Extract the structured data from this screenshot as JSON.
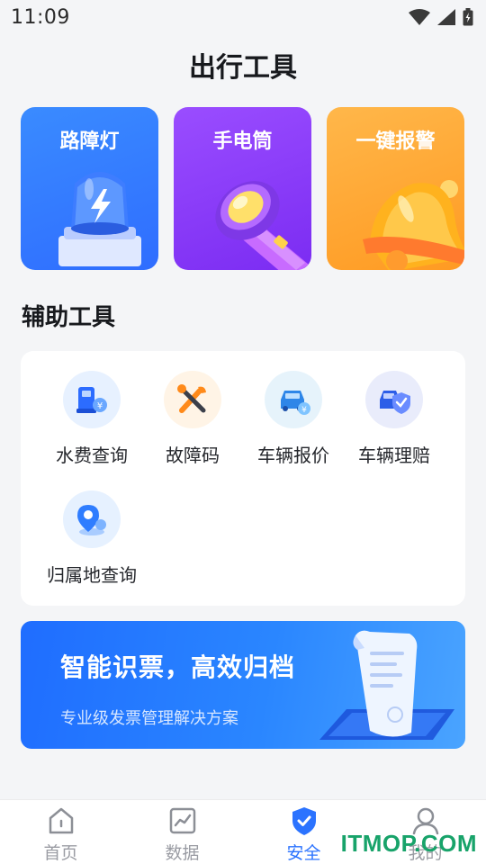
{
  "status_bar": {
    "time": "11:09"
  },
  "page_title": "出行工具",
  "tool_cards": [
    {
      "label": "路障灯",
      "icon": "warning-light-icon"
    },
    {
      "label": "手电筒",
      "icon": "flashlight-icon"
    },
    {
      "label": "一键报警",
      "icon": "bell-icon"
    }
  ],
  "aux_section": {
    "title": "辅助工具",
    "items": [
      {
        "label": "水费查询",
        "icon": "water-fee-icon"
      },
      {
        "label": "故障码",
        "icon": "tools-icon"
      },
      {
        "label": "车辆报价",
        "icon": "car-price-icon"
      },
      {
        "label": "车辆理赔",
        "icon": "car-claim-icon"
      },
      {
        "label": "归属地查询",
        "icon": "location-icon"
      }
    ]
  },
  "banner": {
    "title": "智能识票，高效归档",
    "subtitle": "专业级发票管理解决方案"
  },
  "tab_bar": {
    "tabs": [
      {
        "label": "首页",
        "icon": "home-icon",
        "active": false
      },
      {
        "label": "数据",
        "icon": "chart-icon",
        "active": false
      },
      {
        "label": "安全",
        "icon": "shield-icon",
        "active": true
      },
      {
        "label": "我的",
        "icon": "user-icon",
        "active": false
      }
    ]
  },
  "watermark": "ITMOP.COM",
  "colors": {
    "accent": "#2b73ff",
    "roadblock_card": "#3a8bff",
    "flashlight_card": "#8a3cf8",
    "alarm_card": "#ffa532",
    "watermark": "#18a36a"
  }
}
